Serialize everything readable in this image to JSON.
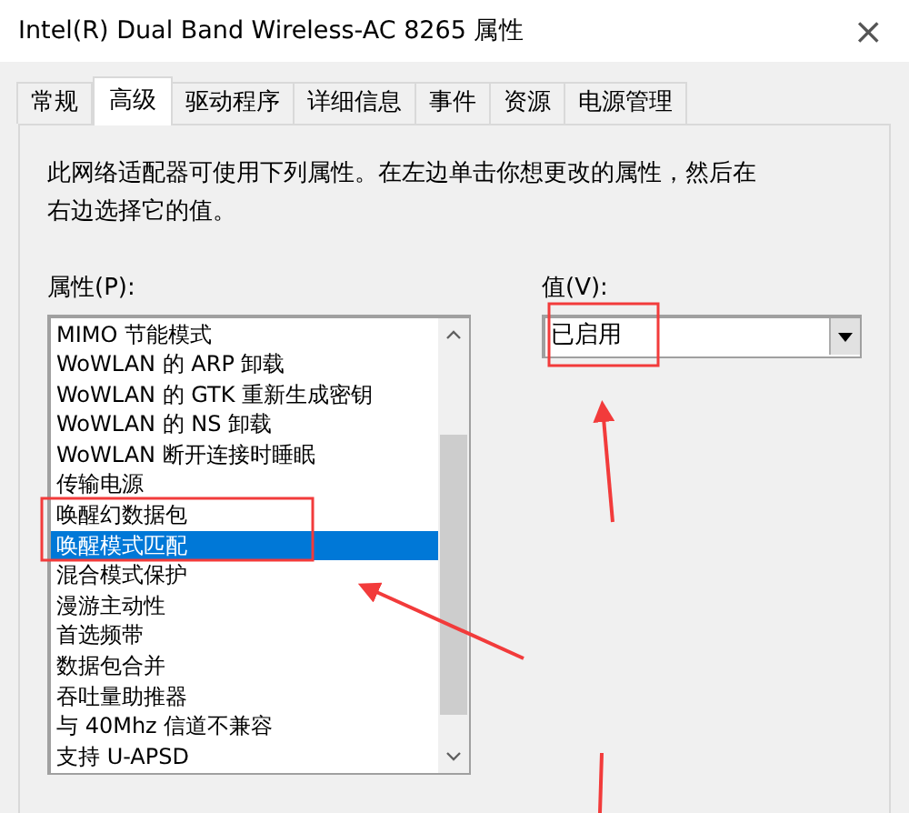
{
  "window": {
    "title": "Intel(R) Dual Band Wireless-AC 8265 属性",
    "close": "×"
  },
  "tabs": [
    {
      "label": "常规",
      "selected": false
    },
    {
      "label": "高级",
      "selected": true
    },
    {
      "label": "驱动程序",
      "selected": false
    },
    {
      "label": "详细信息",
      "selected": false
    },
    {
      "label": "事件",
      "selected": false
    },
    {
      "label": "资源",
      "selected": false
    },
    {
      "label": "电源管理",
      "selected": false
    }
  ],
  "description": "此网络适配器可使用下列属性。在左边单击你想更改的属性，然后在右边选择它的值。",
  "property_label": "属性(P):",
  "properties": [
    {
      "label": "MIMO 节能模式",
      "selected": false
    },
    {
      "label": "WoWLAN 的 ARP 卸载",
      "selected": false
    },
    {
      "label": "WoWLAN 的 GTK 重新生成密钥",
      "selected": false
    },
    {
      "label": "WoWLAN 的 NS 卸载",
      "selected": false
    },
    {
      "label": "WoWLAN 断开连接时睡眠",
      "selected": false
    },
    {
      "label": "传输电源",
      "selected": false
    },
    {
      "label": "唤醒幻数据包",
      "selected": false
    },
    {
      "label": "唤醒模式匹配",
      "selected": true
    },
    {
      "label": "混合模式保护",
      "selected": false
    },
    {
      "label": "漫游主动性",
      "selected": false
    },
    {
      "label": "首选频带",
      "selected": false
    },
    {
      "label": "数据包合并",
      "selected": false
    },
    {
      "label": "吞吐量助推器",
      "selected": false
    },
    {
      "label": "与 40Mhz 信道不兼容",
      "selected": false
    },
    {
      "label": "支持 U-APSD",
      "selected": false
    }
  ],
  "value_label": "值(V):",
  "value": "已启用"
}
